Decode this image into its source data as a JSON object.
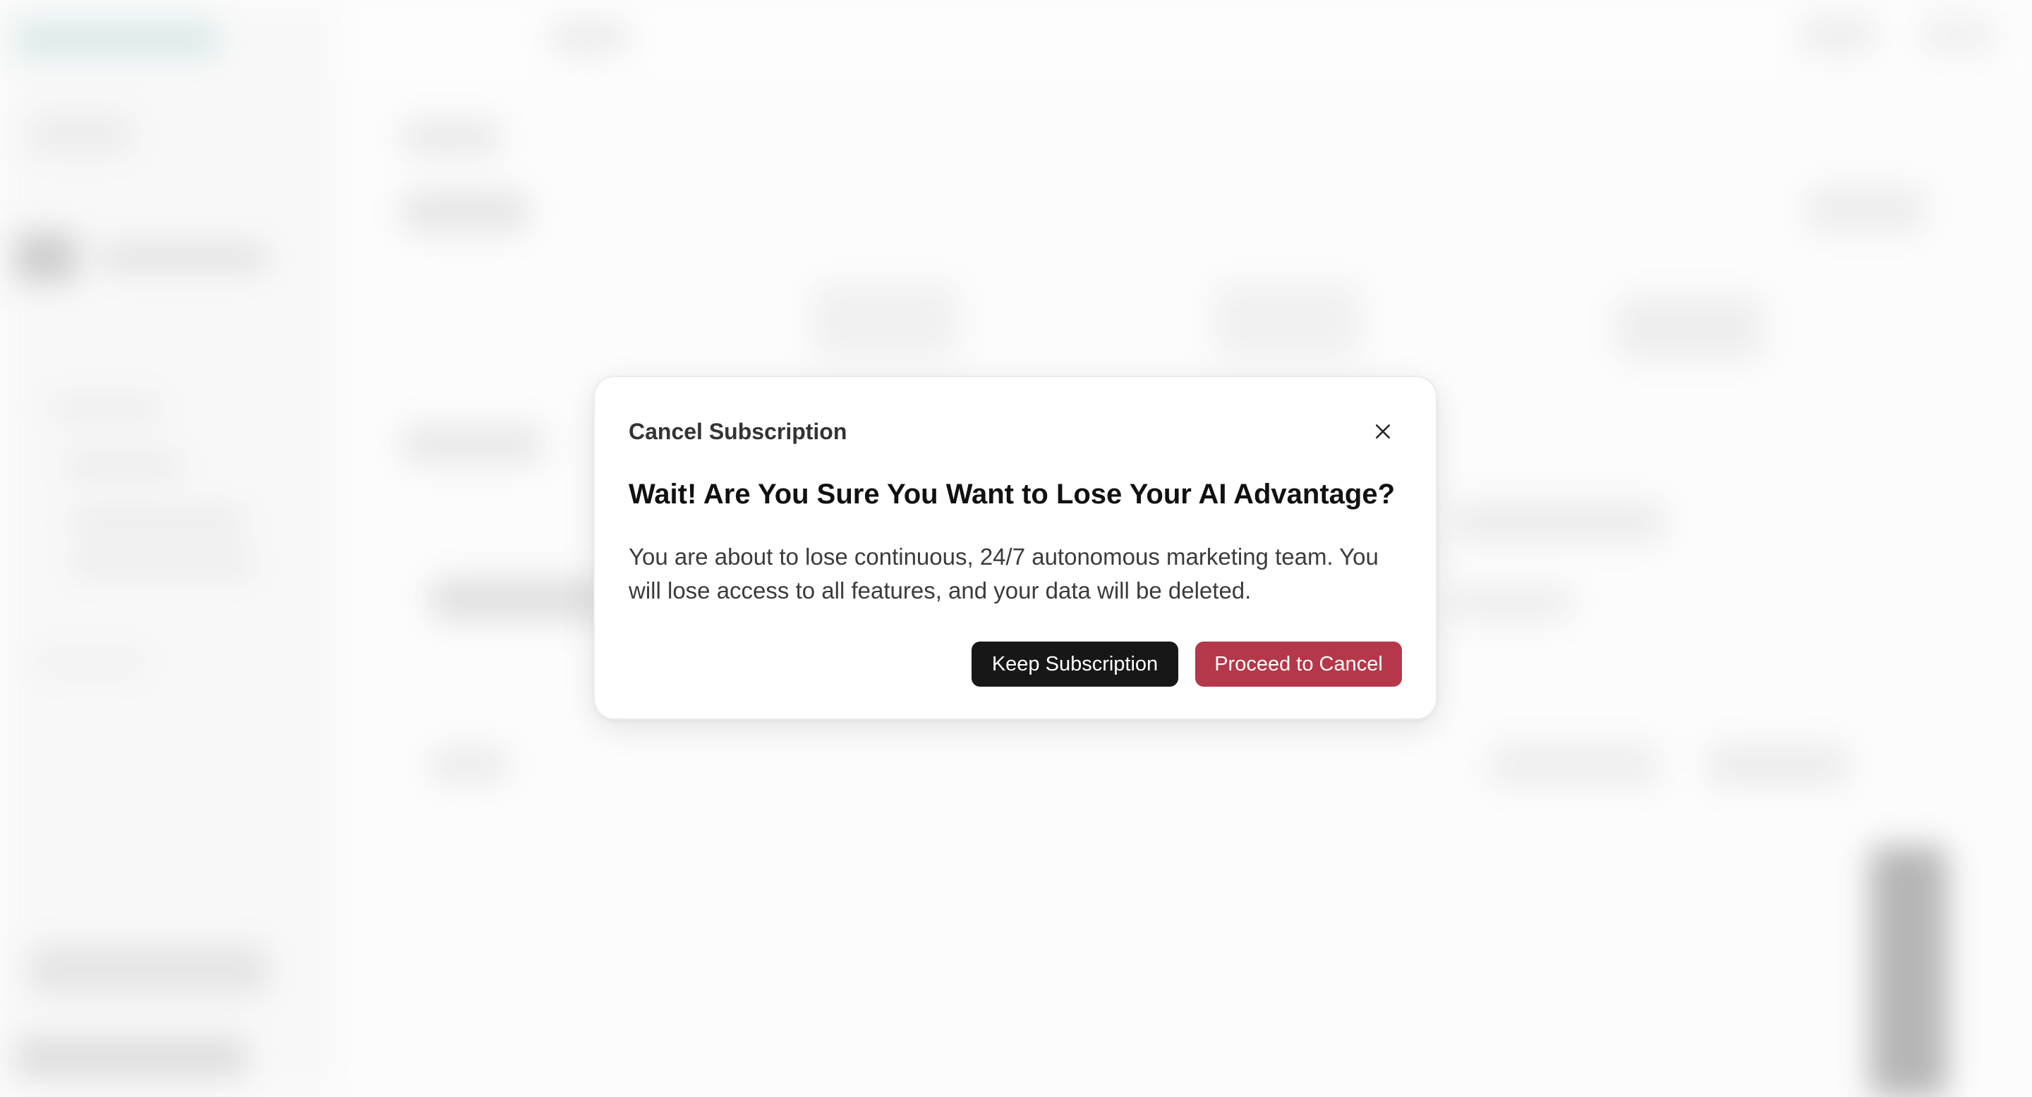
{
  "dialog": {
    "title": "Cancel Subscription",
    "heading": "Wait! Are You Sure You Want to Lose Your AI Advantage?",
    "body": "You are about to lose continuous, 24/7 autonomous marketing team. You will lose access to all features, and your data will be deleted.",
    "keep_label": "Keep Subscription",
    "proceed_label": "Proceed to Cancel",
    "close_icon": "close-icon"
  },
  "colors": {
    "keep_button": "#171717",
    "proceed_button": "#b5374a",
    "dialog_background": "#ffffff"
  }
}
